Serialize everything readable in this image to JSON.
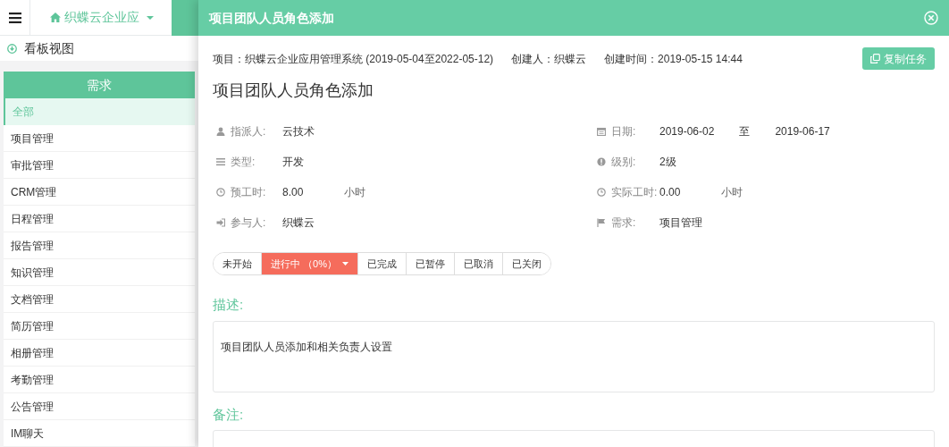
{
  "app_bar": {
    "brand": "织蝶云企业应"
  },
  "view_header": {
    "title": "看板视图"
  },
  "sidebar": {
    "header": "需求",
    "items": [
      {
        "label": "全部",
        "selected": true
      },
      {
        "label": "项目管理",
        "selected": false
      },
      {
        "label": "审批管理",
        "selected": false
      },
      {
        "label": "CRM管理",
        "selected": false
      },
      {
        "label": "日程管理",
        "selected": false
      },
      {
        "label": "报告管理",
        "selected": false
      },
      {
        "label": "知识管理",
        "selected": false
      },
      {
        "label": "文档管理",
        "selected": false
      },
      {
        "label": "简历管理",
        "selected": false
      },
      {
        "label": "相册管理",
        "selected": false
      },
      {
        "label": "考勤管理",
        "selected": false
      },
      {
        "label": "公告管理",
        "selected": false
      },
      {
        "label": "IM聊天",
        "selected": false
      }
    ]
  },
  "modal": {
    "title": "项目团队人员角色添加",
    "meta": [
      "项目：织蝶云企业应用管理系统 (2019-05-04至2022-05-12)",
      "创建人：织蝶云",
      "创建时间：2019-05-15 14:44"
    ],
    "copy_button": "复制任务",
    "task_title": "项目团队人员角色添加",
    "left_fields": [
      {
        "label": "指派人:",
        "values": [
          "云技术"
        ]
      },
      {
        "label": "类型:",
        "values": [
          "开发"
        ]
      },
      {
        "label": "预工时:",
        "values": [
          "8.00",
          "小时"
        ]
      },
      {
        "label": "参与人:",
        "values": [
          "织蝶云"
        ]
      }
    ],
    "right_fields": [
      {
        "label": "日期:",
        "values": [
          "2019-06-02",
          "至",
          "2019-06-17"
        ]
      },
      {
        "label": "级别:",
        "values": [
          "2级"
        ]
      },
      {
        "label": "实际工时:",
        "values": [
          "0.00",
          "小时"
        ]
      },
      {
        "label": "需求:",
        "values": [
          "项目管理"
        ]
      }
    ],
    "status_buttons": [
      {
        "label": "未开始",
        "selected": false
      },
      {
        "label": "进行中 （0%）",
        "selected": true
      },
      {
        "label": "已完成",
        "selected": false
      },
      {
        "label": "已暂停",
        "selected": false
      },
      {
        "label": "已取消",
        "selected": false
      },
      {
        "label": "已关闭",
        "selected": false
      }
    ],
    "description_label": "描述:",
    "description": "项目团队人员添加和相关负责人设置",
    "remark_label": "备注:"
  }
}
